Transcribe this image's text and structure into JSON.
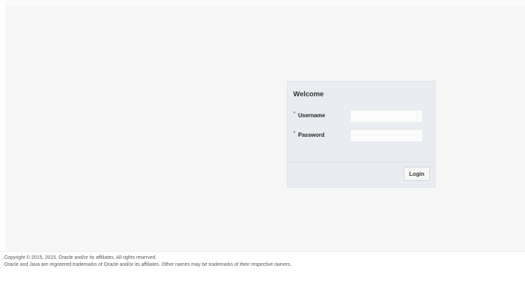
{
  "login": {
    "title": "Welcome",
    "required_marker": "*",
    "username": {
      "label": "Username",
      "value": "",
      "placeholder": ""
    },
    "password": {
      "label": "Password",
      "value": "",
      "placeholder": ""
    },
    "login_button_label": "Login"
  },
  "footer": {
    "copyright": "Copyright © 2015, 2015, Oracle and/or its affiliates. All rights reserved.",
    "trademark": "Oracle and Java are registered trademarks of Oracle and/or its affiliates. Other names may be trademarks of their respective owners."
  },
  "colors": {
    "page_background": "#f6f6f6",
    "panel_background": "#e9edf1",
    "required_marker": "#3a78c2",
    "input_background": "#fbfbfb",
    "footer_text": "#555555"
  }
}
